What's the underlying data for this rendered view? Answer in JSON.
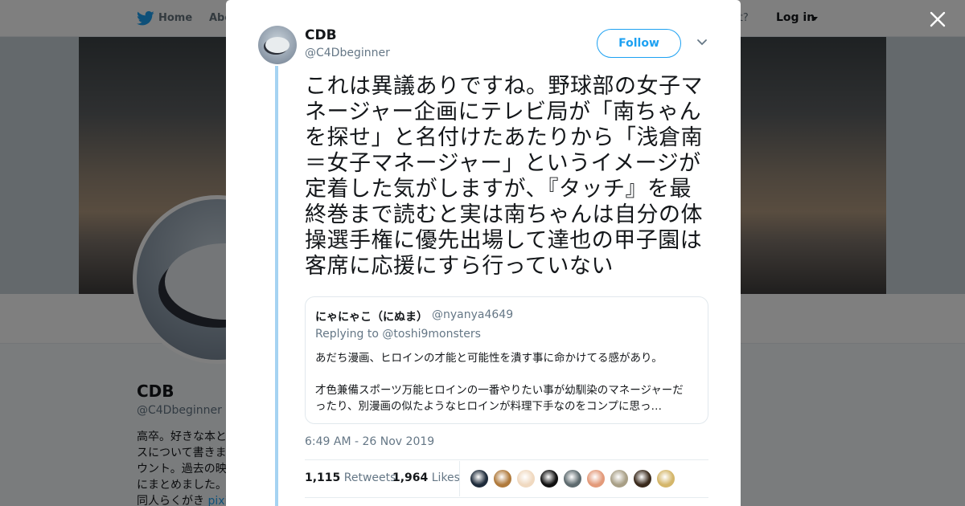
{
  "nav": {
    "home": "Home",
    "about": "Abo",
    "account_prompt": "ccount?",
    "login": "Log in"
  },
  "profile": {
    "name": "CDB",
    "handle": "@C4Dbeginner",
    "bio_lines": [
      "高卒。好きな本と",
      "スについて書きま",
      "ウント。過去の映",
      "にまとめました。",
      "同人らくがき "
    ],
    "bio_link": "pixiv"
  },
  "tweet": {
    "author_name": "CDB",
    "author_handle": "@C4Dbeginner",
    "follow_label": "Follow",
    "text_lines": [
      "これは異議ありですね。野球部の女子マ",
      "ネージャー企画にテレビ局が「南ちゃん",
      "を探せ」と名付けたあたりから「浅倉南",
      "＝女子マネージャー」というイメージが",
      "定着した気がしますが、『タッチ』を最",
      "終巻まで読むと実は南ちゃんは自分の体",
      "操選手権に優先出場して達也の甲子園は",
      "客席に応援にすら行っていない"
    ],
    "timestamp": "6:49 AM - 26 Nov 2019",
    "retweets_count": "1,115",
    "retweets_label": "Retweets",
    "likes_count": "1,964",
    "likes_label": "Likes"
  },
  "quote": {
    "author_name": "にゃにゃこ（にぬま）",
    "author_handle": "@nyanya4649",
    "replying_prefix": "Replying to ",
    "replying_to": "@toshi9monsters",
    "text_lines": [
      "あだち漫画、ヒロインの才能と可能性を潰す事に命かけてる感があり。",
      "",
      "才色兼備スポーツ万能ヒロインの一番やりたい事が幼馴染のマネージャーだ",
      "ったり、別漫画の似たようなヒロインが料理下手なのをコンプに思っ…"
    ]
  },
  "likers": [
    {
      "name": "liker-avatar-1",
      "color": "#1e2b3a"
    },
    {
      "name": "liker-avatar-2",
      "color": "#b07a3c"
    },
    {
      "name": "liker-avatar-3",
      "color": "#f0d9c0"
    },
    {
      "name": "liker-avatar-4",
      "color": "#111111"
    },
    {
      "name": "liker-avatar-5",
      "color": "#5d6a6e"
    },
    {
      "name": "liker-avatar-6",
      "color": "#e39a7a"
    },
    {
      "name": "liker-avatar-7",
      "color": "#a89f86"
    },
    {
      "name": "liker-avatar-8",
      "color": "#3a2a1c"
    },
    {
      "name": "liker-avatar-9",
      "color": "#d4b66a"
    }
  ],
  "colors": {
    "accent": "#1da1f2",
    "thread_line": "#a5d3f2",
    "text_primary": "#14171a",
    "text_secondary": "#657786"
  }
}
